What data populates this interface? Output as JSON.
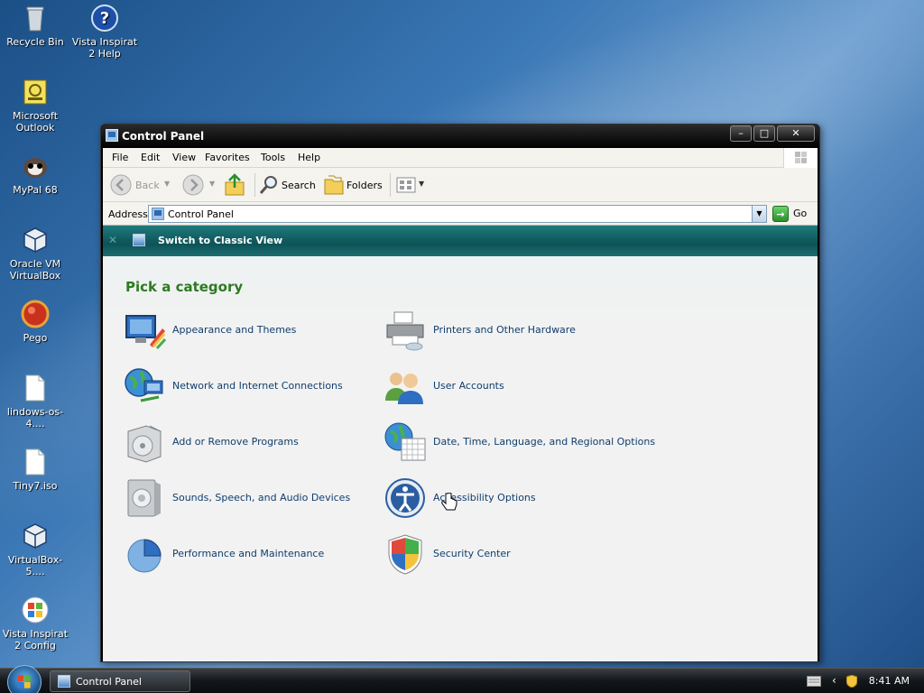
{
  "desktop": {
    "icons": [
      {
        "label": "Recycle Bin"
      },
      {
        "label": "Vista Inspirat 2 Help"
      },
      {
        "label": "Microsoft Outlook"
      },
      {
        "label": "MyPal 68"
      },
      {
        "label": "Oracle VM VirtualBox"
      },
      {
        "label": "Pego"
      },
      {
        "label": "lindows-os-4...."
      },
      {
        "label": "Tiny7.iso"
      },
      {
        "label": "VirtualBox-5...."
      },
      {
        "label": "Vista Inspirat 2 Config"
      }
    ]
  },
  "window": {
    "title": "Control Panel",
    "menu": [
      "File",
      "Edit",
      "View",
      "Favorites",
      "Tools",
      "Help"
    ],
    "toolbar": {
      "back": "Back",
      "search": "Search",
      "folders": "Folders"
    },
    "address": {
      "label": "Address",
      "value": "Control Panel",
      "go": "Go"
    },
    "banner": {
      "text": "Switch to Classic View"
    },
    "content": {
      "heading": "Pick a category",
      "categories": [
        {
          "label": "Appearance and Themes"
        },
        {
          "label": "Printers and Other Hardware"
        },
        {
          "label": "Network and Internet Connections"
        },
        {
          "label": "User Accounts"
        },
        {
          "label": "Add or Remove Programs"
        },
        {
          "label": "Date, Time, Language, and Regional Options"
        },
        {
          "label": "Sounds, Speech, and Audio Devices"
        },
        {
          "label": "Accessibility Options"
        },
        {
          "label": "Performance and Maintenance"
        },
        {
          "label": "Security Center"
        }
      ]
    }
  },
  "taskbar": {
    "task_label": "Control Panel",
    "clock": "8:41 AM"
  }
}
